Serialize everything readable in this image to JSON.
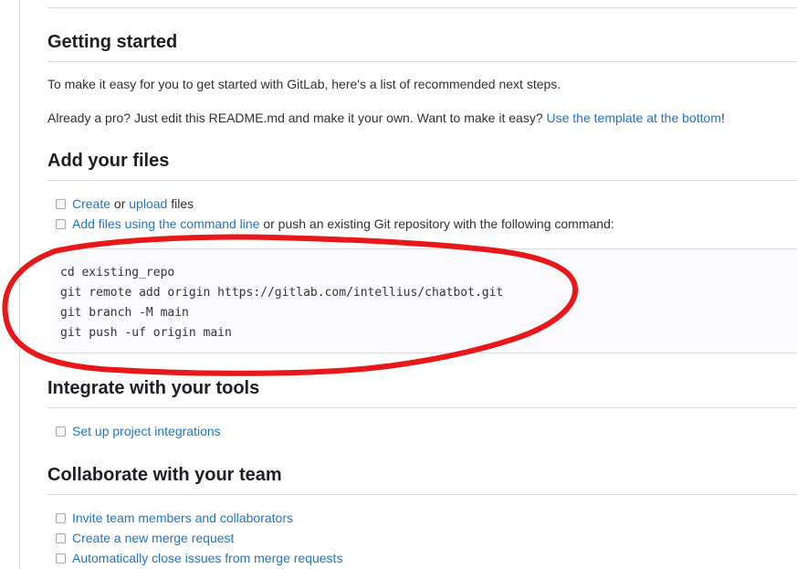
{
  "sections": {
    "getting_started": {
      "title": "Getting started",
      "intro": "To make it easy for you to get started with GitLab, here's a list of recommended next steps.",
      "pro_text": "Already a pro? Just edit this README.md and make it your own. Want to make it easy? ",
      "pro_link": "Use the template at the bottom",
      "pro_suffix": "!"
    },
    "add_files": {
      "title": "Add your files",
      "task1_link1": "Create",
      "task1_mid": " or ",
      "task1_link2": "upload",
      "task1_suffix": " files",
      "task2_link": "Add files using the command line",
      "task2_suffix": " or push an existing Git repository with the following command:",
      "code_lines": [
        "cd existing_repo",
        "git remote add origin https://gitlab.com/intellius/chatbot.git",
        "git branch -M main",
        "git push -uf origin main"
      ]
    },
    "integrate": {
      "title": "Integrate with your tools",
      "tasks": [
        "Set up project integrations"
      ]
    },
    "collaborate": {
      "title": "Collaborate with your team",
      "tasks": [
        "Invite team members and collaborators",
        "Create a new merge request",
        "Automatically close issues from merge requests"
      ]
    }
  },
  "colors": {
    "link": "#1f75cb",
    "annotation": "#e8171a",
    "heading": "#1f1e24"
  }
}
